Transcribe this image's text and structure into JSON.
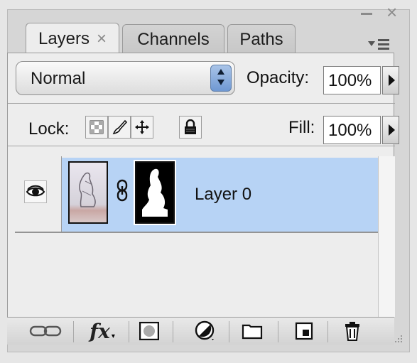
{
  "tabs": [
    {
      "label": "Layers",
      "close": "×"
    },
    {
      "label": "Channels"
    },
    {
      "label": "Paths"
    }
  ],
  "window": {
    "minimize": "–",
    "close": "×"
  },
  "blend_mode": {
    "value": "Normal"
  },
  "opacity": {
    "label": "Opacity:",
    "value": "100%"
  },
  "lock": {
    "label": "Lock:",
    "icons": [
      "lock-transparent-icon",
      "lock-image-icon",
      "lock-position-icon",
      "lock-all-icon"
    ]
  },
  "fill": {
    "label": "Fill:",
    "value": "100%"
  },
  "layers": [
    {
      "name": "Layer 0",
      "visible": true,
      "selected": true,
      "has_mask": true
    }
  ],
  "bottom_buttons": [
    "link-layers-icon",
    "fx-icon",
    "add-mask-icon",
    "adjustment-layer-icon",
    "new-group-icon",
    "new-layer-icon",
    "delete-layer-icon"
  ],
  "fx_label": "fx",
  "colors": {
    "selection": "#b7d3f5",
    "stepper": "#6f98d2"
  }
}
